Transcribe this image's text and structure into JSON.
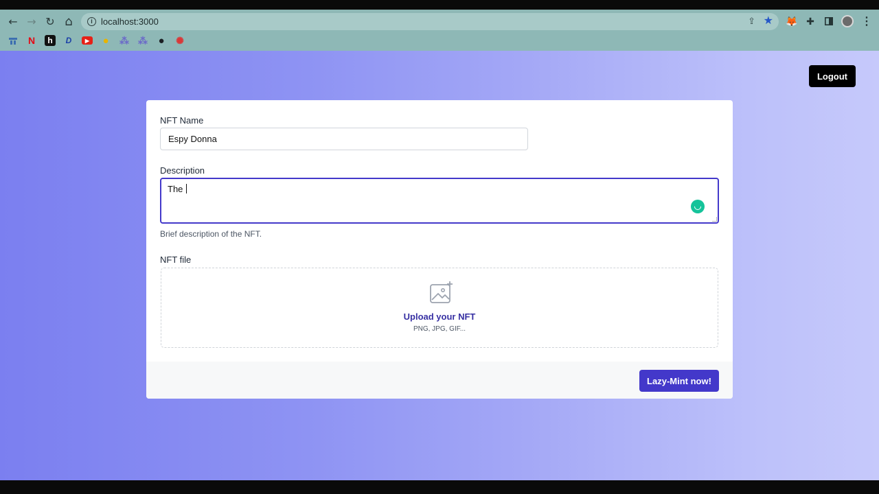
{
  "browser": {
    "url": "localhost:3000",
    "nav_icons": {
      "back": "←",
      "forward": "→",
      "reload": "↻",
      "home": "⌂"
    },
    "extensions": [
      "metamask-fox-icon",
      "puzzle-extensions-icon",
      "sidepanel-icon",
      "profile-avatar",
      "menu-kebab-icon"
    ],
    "bookmarks": [
      {
        "name": "bookmark-1",
        "glyph": "",
        "color": "#3d6fb0"
      },
      {
        "name": "netflix",
        "glyph": "N",
        "color": "#e50914"
      },
      {
        "name": "h-site",
        "glyph": "h",
        "color": "#111111"
      },
      {
        "name": "disney",
        "glyph": "D",
        "color": "#1a3fa8"
      },
      {
        "name": "youtube",
        "glyph": "▶",
        "color": "#e62117"
      },
      {
        "name": "yellow-site",
        "glyph": "●",
        "color": "#e8b400"
      },
      {
        "name": "cluster-1",
        "glyph": "⁂",
        "color": "#6c6cc8"
      },
      {
        "name": "cluster-2",
        "glyph": "⁂",
        "color": "#6c6cc8"
      },
      {
        "name": "github",
        "glyph": "●",
        "color": "#1b1f23"
      },
      {
        "name": "red-site",
        "glyph": "✺",
        "color": "#d93838"
      }
    ]
  },
  "header": {
    "logout_label": "Logout"
  },
  "form": {
    "name_label": "NFT Name",
    "name_value": "Espy Donna",
    "description_label": "Description",
    "description_value": "The ",
    "description_hint": "Brief description of the NFT.",
    "file_label": "NFT file",
    "upload_title": "Upload your NFT",
    "upload_types": "PNG, JPG, GIF..."
  },
  "footer": {
    "mint_label": "Lazy-Mint now!"
  },
  "colors": {
    "accent": "#4338ca",
    "grammarly": "#15c39a"
  }
}
